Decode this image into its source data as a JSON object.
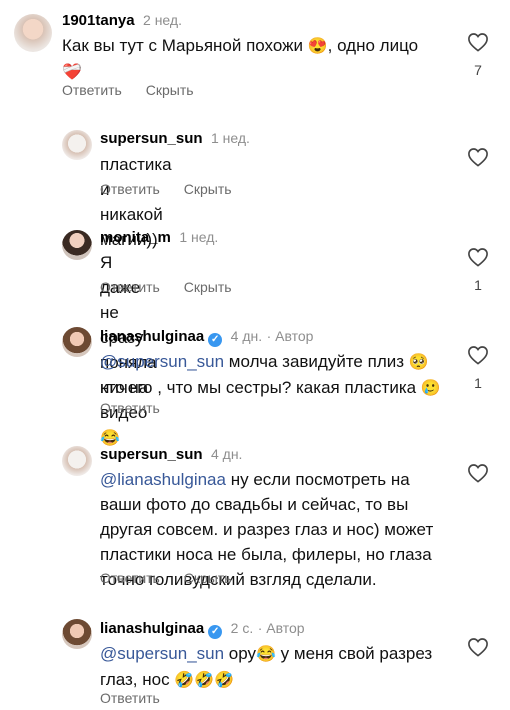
{
  "comments": [
    {
      "username": "1901tanya",
      "time": "2 нед.",
      "text": "Как вы тут с Марьяной похожи",
      "emoji1": "😍",
      "text_after": ", одно лицо",
      "emoji2": "❤️‍🩹",
      "reply_label": "Ответить",
      "hide_label": "Скрыть",
      "likes": "7"
    },
    {
      "username": "supersun_sun",
      "time": "1 нед.",
      "text": "пластика и никакой магии))",
      "reply_label": "Ответить",
      "hide_label": "Скрыть"
    },
    {
      "username": "monita_m",
      "time": "1 нед.",
      "text": "Я даже не сразу поняла кто на видео",
      "emoji": "😂",
      "reply_label": "Ответить",
      "hide_label": "Скрыть",
      "likes": "1"
    },
    {
      "username": "lianashulginaa",
      "time": "4 дн.",
      "author_label": "· Автор",
      "mention": "@supersun_sun",
      "text": "молча завидуйте плиз",
      "emoji1": "🥺",
      "text2": "ничего , что мы сестры? какая пластика",
      "emoji2": "🥲",
      "reply_label": "Ответить",
      "likes": "1"
    },
    {
      "username": "supersun_sun",
      "time": "4 дн.",
      "mention": "@lianashulginaa",
      "text1": "ну если посмотреть на",
      "text2": "ваши фото до свадьбы и сейчас, то вы",
      "text3": "другая совсем. и разрез глаз и нос) может",
      "text4": "пластики носа не была, филеры, но глаза",
      "text5": "точно голивудский взгляд сделали.",
      "reply_label": "Ответить",
      "hide_label": "Скрыть"
    },
    {
      "username": "lianashulginaa",
      "time": "2 с.",
      "author_label": "· Автор",
      "mention": "@supersun_sun",
      "text": "ору",
      "emoji1": "😂",
      "text_after": "у меня свой разрез",
      "text2": "глаз, нос",
      "emoji2": "🤣🤣🤣",
      "reply_label": "Ответить"
    }
  ],
  "colors": {
    "mention": "#385898",
    "verified": "#3897f0",
    "secondary": "#8e8e8e"
  },
  "icons": {
    "like": "heart-outline-icon",
    "verified": "verified-badge-icon"
  }
}
